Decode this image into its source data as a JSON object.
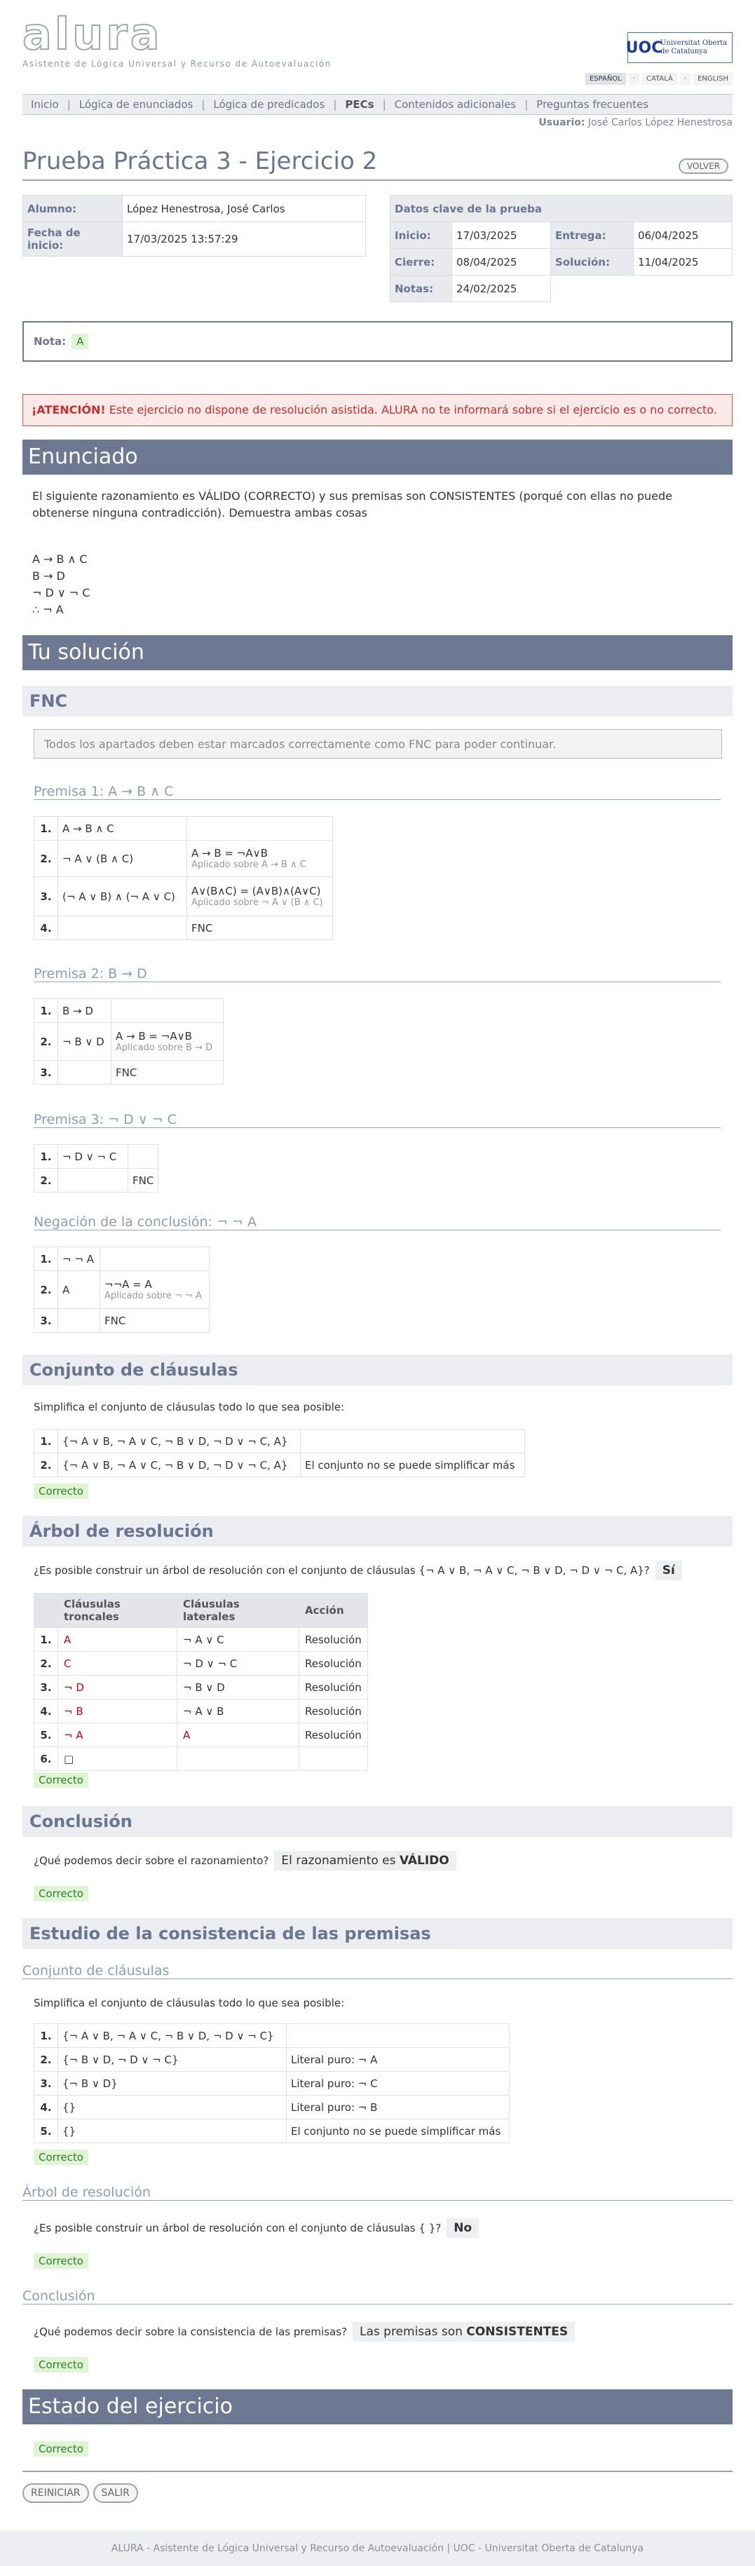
{
  "header": {
    "logo": "alura",
    "subtitle": "Asistente de Lógica Universal y Recurso de Autoevaluación",
    "uoc_logo": "UOC",
    "uoc_name_1": "Universitat Oberta",
    "uoc_name_2": "de Catalunya",
    "langs": [
      "ESPAÑOL",
      "CATALÀ",
      "ENGLISH"
    ]
  },
  "nav": {
    "items": [
      "Inicio",
      "Lógica de enunciados",
      "Lógica de predicados",
      "PECs",
      "Contenidos adicionales",
      "Preguntas frecuentes"
    ]
  },
  "user": {
    "label": "Usuario:",
    "name": "José Carlos López Henestrosa"
  },
  "title": "Prueba Práctica 3 - Ejercicio 2",
  "volver": "VOLVER",
  "alumno": {
    "alumno_label": "Alumno:",
    "alumno": "López Henestrosa, José Carlos",
    "fecha_label": "Fecha de inicio:",
    "fecha": "17/03/2025 13:57:29"
  },
  "datos": {
    "title": "Datos clave de la prueba",
    "inicio_label": "Inicio:",
    "inicio": "17/03/2025",
    "entrega_label": "Entrega:",
    "entrega": "06/04/2025",
    "cierre_label": "Cierre:",
    "cierre": "08/04/2025",
    "solucion_label": "Solución:",
    "solucion": "11/04/2025",
    "notas_label": "Notas:",
    "notas": "24/02/2025"
  },
  "nota": {
    "label": "Nota:",
    "value": "A"
  },
  "warning": {
    "bold": "¡ATENCIÓN!",
    "text": " Este ejercicio no dispone de resolución asistida. ALURA no te informará sobre si el ejercicio es o no correcto."
  },
  "enunciado": {
    "title": "Enunciado",
    "text": "El siguiente razonamiento es VÁLIDO (CORRECTO) y sus premisas son CONSISTENTES (porqué con ellas no puede obtenerse ninguna contradicción). Demuestra ambas cosas",
    "lines": [
      "A → B ∧ C",
      "B → D",
      "¬ D ∨ ¬ C",
      "∴ ¬ A"
    ]
  },
  "solucion": {
    "title": "Tu solución"
  },
  "fnc": {
    "title": "FNC",
    "info": "Todos los apartados deben estar marcados correctamente como FNC para poder continuar."
  },
  "premisa1": {
    "title": "Premisa 1: A → B ∧ C",
    "rows": [
      [
        "1.",
        "A → B ∧ C",
        ""
      ],
      [
        "2.",
        "¬ A ∨ (B ∧ C)",
        "A → B = ¬A∨B"
      ],
      [
        "3.",
        "(¬ A ∨ B) ∧ (¬ A ∨ C)",
        "A∨(B∧C) = (A∨B)∧(A∨C)"
      ],
      [
        "4.",
        "",
        "FNC"
      ]
    ],
    "apply2": "Aplicado sobre A → B ∧ C",
    "apply3": "Aplicado sobre ¬ A ∨ (B ∧ C)"
  },
  "premisa2": {
    "title": "Premisa 2: B → D",
    "rows": [
      [
        "1.",
        "B → D",
        ""
      ],
      [
        "2.",
        "¬ B ∨ D",
        "A → B = ¬A∨B"
      ],
      [
        "3.",
        "",
        "FNC"
      ]
    ],
    "apply2": "Aplicado sobre B → D"
  },
  "premisa3": {
    "title": "Premisa 3: ¬ D ∨ ¬ C",
    "rows": [
      [
        "1.",
        "¬ D ∨ ¬ C",
        ""
      ],
      [
        "2.",
        "",
        "FNC"
      ]
    ]
  },
  "negacion": {
    "title": "Negación de la conclusión: ¬ ¬ A",
    "rows": [
      [
        "1.",
        "¬ ¬ A",
        ""
      ],
      [
        "2.",
        "A",
        "¬¬A = A"
      ],
      [
        "3.",
        "",
        "FNC"
      ]
    ],
    "apply2": "Aplicado sobre ¬ ¬ A"
  },
  "conjunto": {
    "title": "Conjunto de cláusulas",
    "intro": "Simplifica el conjunto de cláusulas todo lo que sea posible:",
    "rows": [
      [
        "1.",
        "{¬ A ∨ B, ¬ A ∨ C, ¬ B ∨ D, ¬ D ∨ ¬ C, A}",
        ""
      ],
      [
        "2.",
        "{¬ A ∨ B, ¬ A ∨ C, ¬ B ∨ D, ¬ D ∨ ¬ C, A}",
        "El conjunto no se puede simplificar más"
      ]
    ],
    "status": "Correcto"
  },
  "arbol": {
    "title": "Árbol de resolución",
    "question": "¿Es posible construir un árbol de resolución con el conjunto de cláusulas {¬ A ∨ B, ¬ A ∨ C, ¬ B ∨ D, ¬ D ∨ ¬ C, A}?",
    "answer": "Sí",
    "headers": [
      "Cláusulas troncales",
      "Cláusulas laterales",
      "Acción"
    ],
    "rows": [
      [
        "1.",
        "A",
        "¬ A ∨ C",
        "Resolución"
      ],
      [
        "2.",
        "C",
        "¬ D ∨ ¬ C",
        "Resolución"
      ],
      [
        "3.",
        "¬ D",
        "¬ B ∨ D",
        "Resolución"
      ],
      [
        "4.",
        "¬ B",
        "¬ A ∨ B",
        "Resolución"
      ],
      [
        "5.",
        "¬ A",
        "A",
        "Resolución"
      ],
      [
        "6.",
        "□",
        "",
        ""
      ]
    ],
    "status": "Correcto"
  },
  "conclusion": {
    "title": "Conclusión",
    "question": "¿Qué podemos decir sobre el razonamiento?",
    "answer_pre": "El razonamiento es ",
    "answer_bold": "VÁLIDO",
    "status": "Correcto"
  },
  "consistencia": {
    "title": "Estudio de la consistencia de las premisas",
    "conj_title": "Conjunto de cláusulas",
    "intro": "Simplifica el conjunto de cláusulas todo lo que sea posible:",
    "rows": [
      [
        "1.",
        "{¬ A ∨ B, ¬ A ∨ C, ¬ B ∨ D, ¬ D ∨ ¬ C}",
        ""
      ],
      [
        "2.",
        "{¬ B ∨ D, ¬ D ∨ ¬ C}",
        "Literal puro: ¬ A"
      ],
      [
        "3.",
        "{¬ B ∨ D}",
        "Literal puro: ¬ C"
      ],
      [
        "4.",
        "{}",
        "Literal puro: ¬ B"
      ],
      [
        "5.",
        "{}",
        "El conjunto no se puede simplificar más"
      ]
    ],
    "status1": "Correcto",
    "arbol_title": "Árbol de resolución",
    "arbol_q": "¿Es posible construir un árbol de resolución con el conjunto de cláusulas { }?",
    "arbol_a": "No",
    "status2": "Correcto",
    "concl_title": "Conclusión",
    "concl_q": "¿Qué podemos decir sobre la consistencia de las premisas?",
    "concl_a_pre": "Las premisas son ",
    "concl_a_bold": "CONSISTENTES",
    "status3": "Correcto"
  },
  "estado": {
    "title": "Estado del ejercicio",
    "status": "Correcto"
  },
  "buttons": {
    "reiniciar": "REINICIAR",
    "salir": "SALIR"
  },
  "footer": "ALURA - Asistente de Lógica Universal y Recurso de Autoevaluación | UOC - Universitat Oberta de Catalunya",
  "colors": {
    "section": "#6d7892",
    "subsection": "#ecedf0",
    "correct_bg": "#dff5d3",
    "warning_border": "#d9534f"
  }
}
